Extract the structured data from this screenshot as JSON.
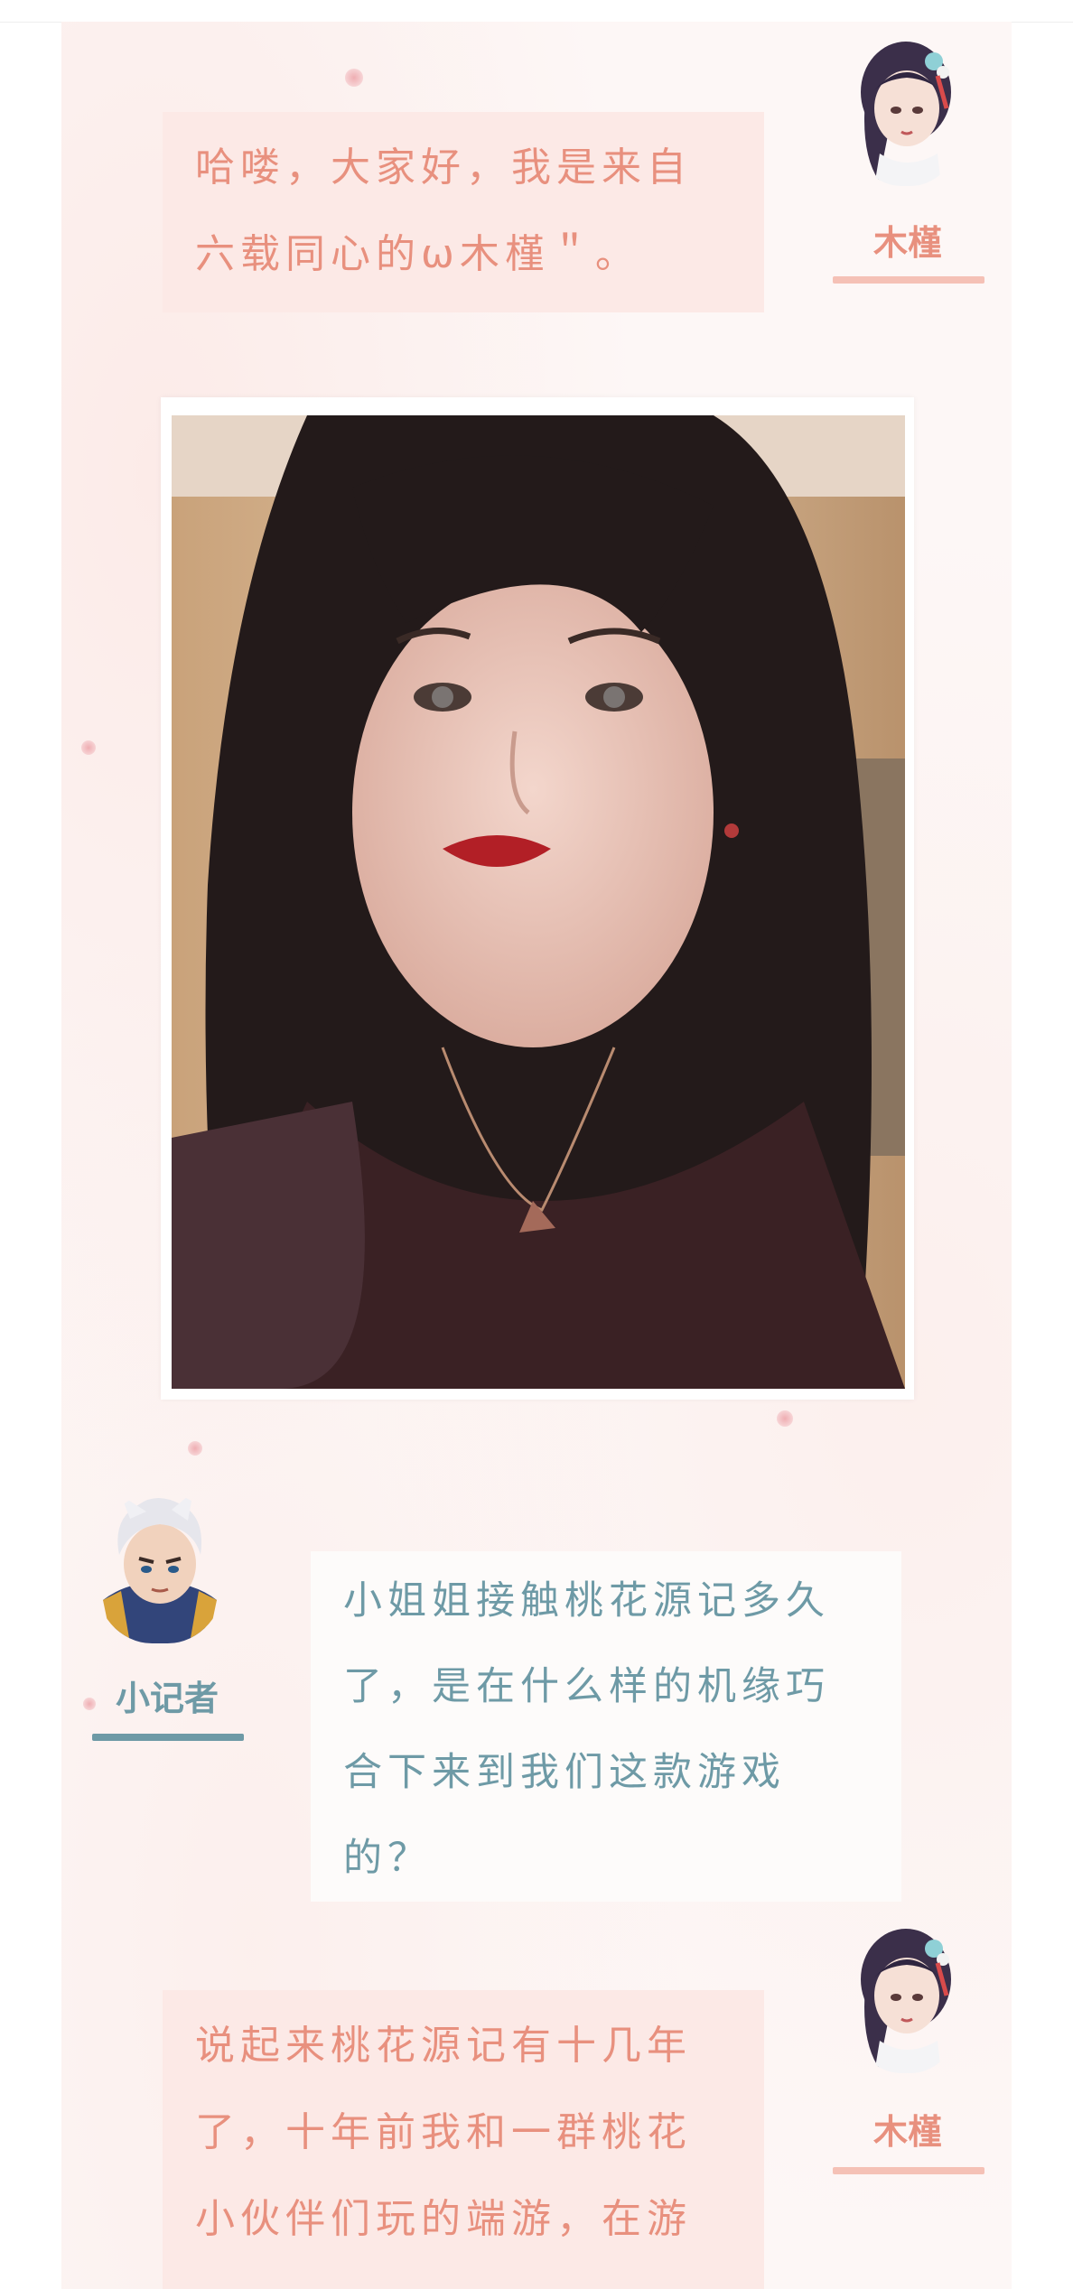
{
  "conversation": [
    {
      "speaker": "木槿",
      "text": "哈喽，大家好，我是来自六载同心的ω木槿＂。"
    },
    {
      "speaker": "小记者",
      "text": "小姐姐接触桃花源记多久了，是在什么样的机缘巧合下来到我们这款游戏的？"
    },
    {
      "speaker": "木槿",
      "text": "说起来桃花源记有十几年了，十年前我和一群桃花小伙伴们玩的端游，在游"
    }
  ],
  "colors": {
    "pink_text": "#e8907e",
    "pink_bubble": "#fce9e6",
    "teal_text": "#6e9aa6",
    "pink_underline": "#f5c1b6",
    "teal_underline": "#6e9aa6"
  },
  "icons": {
    "mujin_avatar": "female-character-avatar",
    "reporter_avatar": "male-character-avatar"
  }
}
